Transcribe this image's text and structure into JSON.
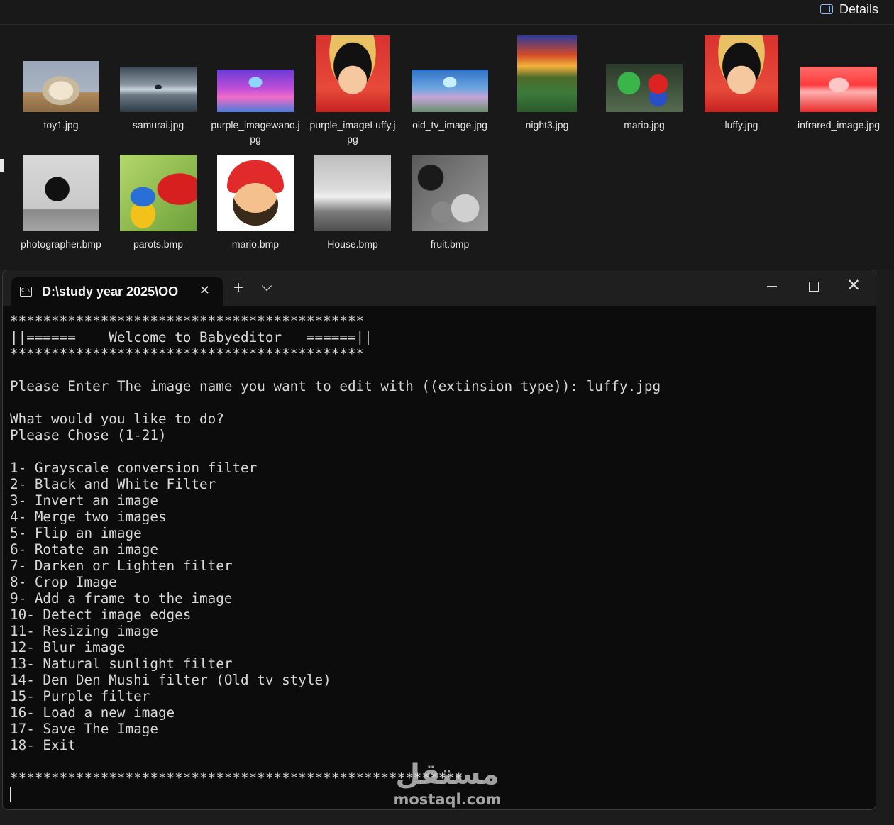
{
  "explorer": {
    "details_label": "Details",
    "files_row1": [
      {
        "name": "toy1.jpg",
        "thumb": "t-toy"
      },
      {
        "name": "samurai.jpg",
        "thumb": "t-sam"
      },
      {
        "name": "purple_imagewano.jpg",
        "thumb": "t-purp"
      },
      {
        "name": "purple_imageLuffy.jpg",
        "thumb": "t-luffy"
      },
      {
        "name": "old_tv_image.jpg",
        "thumb": "t-old"
      },
      {
        "name": "night3.jpg",
        "thumb": "t-night"
      },
      {
        "name": "mario.jpg",
        "thumb": "t-mario"
      },
      {
        "name": "luffy.jpg",
        "thumb": "t-luffy"
      },
      {
        "name": "infrared_image.jpg",
        "thumb": "t-infra"
      }
    ],
    "files_row2": [
      {
        "name": "photographer.bmp",
        "thumb": "t-photo"
      },
      {
        "name": "parots.bmp",
        "thumb": "t-parrot"
      },
      {
        "name": "mario.bmp",
        "thumb": "t-mariob"
      },
      {
        "name": "House.bmp",
        "thumb": "t-house"
      },
      {
        "name": "fruit.bmp",
        "thumb": "t-fruit"
      }
    ]
  },
  "terminal": {
    "tab_title": "D:\\study year 2025\\OO",
    "tab_close": "✕",
    "new_tab": "+",
    "close_glyph": "✕",
    "lines": [
      "*******************************************",
      "||======    Welcome to Babyeditor   ======||",
      "*******************************************",
      "",
      "Please Enter The image name you want to edit with ((extinsion type)): luffy.jpg",
      "",
      "What would you like to do?",
      "Please Chose (1-21)",
      "",
      "1- Grayscale conversion filter",
      "2- Black and White Filter",
      "3- Invert an image",
      "4- Merge two images",
      "5- Flip an image",
      "6- Rotate an image",
      "7- Darken or Lighten filter",
      "8- Crop Image",
      "9- Add a frame to the image",
      "10- Detect image edges",
      "11- Resizing image",
      "12- Blur image",
      "13- Natural sunlight filter",
      "14- Den Den Mushi filter (Old tv style)",
      "15- Purple filter",
      "16- Load a new image",
      "17- Save The Image",
      "18- Exit",
      "",
      "*******************************************************"
    ]
  },
  "watermark": {
    "arabic": "مستقل",
    "latin": "mostaql.com"
  }
}
